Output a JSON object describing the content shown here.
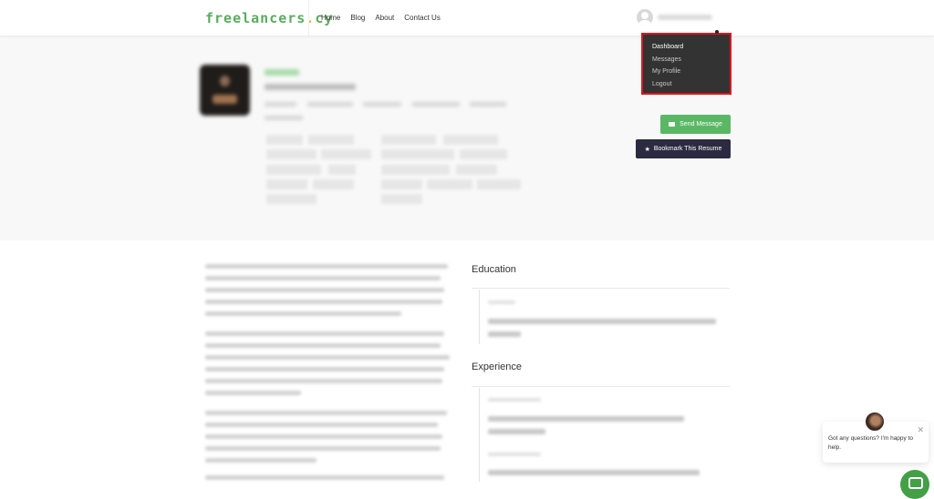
{
  "header": {
    "logo_text": "freelancers",
    "logo_dot": ".",
    "logo_suffix": "cy",
    "nav": [
      "Home",
      "Blog",
      "About",
      "Contact Us"
    ]
  },
  "user_menu": {
    "items": [
      {
        "label": "Dashboard",
        "active": true
      },
      {
        "label": "Messages",
        "active": false
      },
      {
        "label": "My Profile",
        "active": false
      },
      {
        "label": "Logout",
        "active": false
      }
    ]
  },
  "actions": {
    "send_message": "Send Message",
    "bookmark": "Bookmark This Resume"
  },
  "sections": {
    "education": "Education",
    "experience": "Experience"
  },
  "chat": {
    "message": "Got any questions? I'm happy to help.",
    "close": "✕"
  },
  "colors": {
    "brand_green": "#5aac5f",
    "logo_dot": "#e9b94f",
    "send_button": "#5ab865",
    "bookmark_button": "#2b2a40",
    "dropdown_bg": "#333333",
    "highlight_border": "#e0141e"
  }
}
